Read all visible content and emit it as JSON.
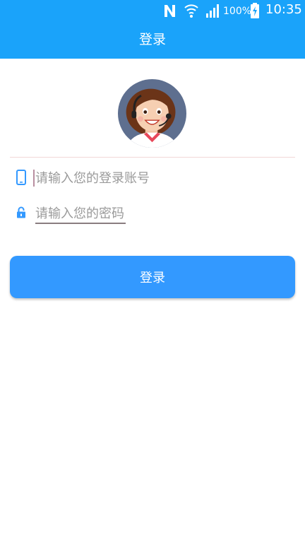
{
  "colors": {
    "header_bg": "#1aa3fa",
    "button_bg": "#3399ff",
    "icon_accent": "#3399ff"
  },
  "status_bar": {
    "battery_percent": "100%",
    "time": "10:35",
    "icons": [
      "nfc-icon",
      "wifi-icon",
      "signal-icon",
      "battery-charging-icon"
    ]
  },
  "header": {
    "title": "登录"
  },
  "form": {
    "avatar_icon": "customer-service-avatar",
    "account": {
      "icon": "phone-icon",
      "placeholder": "请输入您的登录账号",
      "value": ""
    },
    "password": {
      "icon": "lock-icon",
      "placeholder": "请输入您的密码",
      "value": ""
    },
    "login_label": "登录"
  }
}
